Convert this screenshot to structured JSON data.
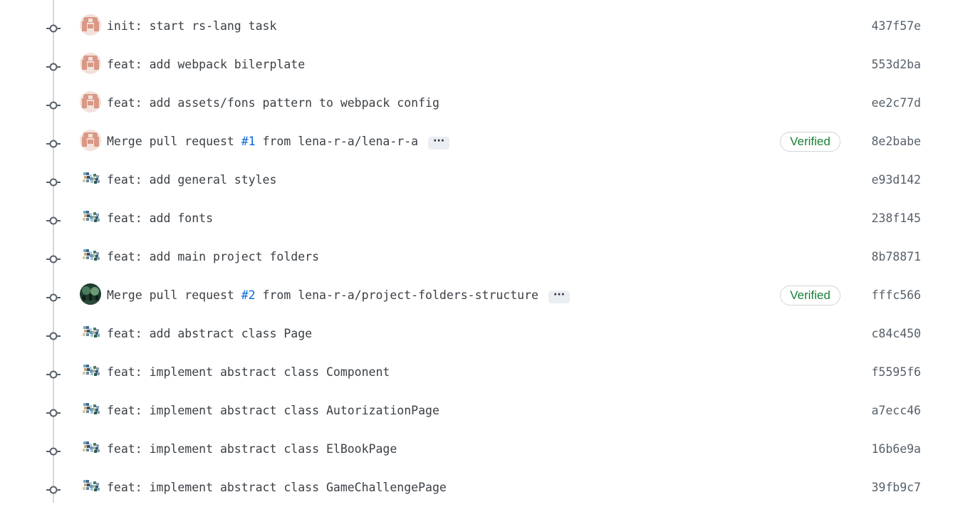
{
  "colors": {
    "timeline": "#d0d7de",
    "text": "#3b4046",
    "link": "#0969da",
    "verified": "#1a7f37",
    "sha": "#57606a"
  },
  "commits": [
    {
      "author_avatar": "identicon-avatar",
      "prefix": "init: start rs-lang task",
      "pr": "",
      "suffix": "",
      "has_ellipsis": false,
      "verified": "",
      "sha": "437f57e"
    },
    {
      "author_avatar": "identicon-avatar",
      "prefix": "feat: add webpack bilerplate",
      "pr": "",
      "suffix": "",
      "has_ellipsis": false,
      "verified": "",
      "sha": "553d2ba"
    },
    {
      "author_avatar": "identicon-avatar",
      "prefix": "feat: add assets/fons pattern to webpack config",
      "pr": "",
      "suffix": "",
      "has_ellipsis": false,
      "verified": "",
      "sha": "ee2c77d"
    },
    {
      "author_avatar": "identicon-avatar",
      "prefix": "Merge pull request ",
      "pr": "#1",
      "suffix": " from lena-r-a/lena-r-a",
      "has_ellipsis": true,
      "verified": "Verified",
      "sha": "8e2babe"
    },
    {
      "author_avatar": "pixel-avatar",
      "prefix": "feat: add general styles",
      "pr": "",
      "suffix": "",
      "has_ellipsis": false,
      "verified": "",
      "sha": "e93d142"
    },
    {
      "author_avatar": "pixel-avatar",
      "prefix": "feat: add fonts",
      "pr": "",
      "suffix": "",
      "has_ellipsis": false,
      "verified": "",
      "sha": "238f145"
    },
    {
      "author_avatar": "pixel-avatar",
      "prefix": "feat: add main project folders",
      "pr": "",
      "suffix": "",
      "has_ellipsis": false,
      "verified": "",
      "sha": "8b78871"
    },
    {
      "author_avatar": "photo-avatar",
      "prefix": "Merge pull request ",
      "pr": "#2",
      "suffix": " from lena-r-a/project-folders-structure",
      "has_ellipsis": true,
      "verified": "Verified",
      "sha": "fffc566"
    },
    {
      "author_avatar": "pixel-avatar",
      "prefix": "feat: add abstract class Page",
      "pr": "",
      "suffix": "",
      "has_ellipsis": false,
      "verified": "",
      "sha": "c84c450"
    },
    {
      "author_avatar": "pixel-avatar",
      "prefix": "feat: implement abstract class Component",
      "pr": "",
      "suffix": "",
      "has_ellipsis": false,
      "verified": "",
      "sha": "f5595f6"
    },
    {
      "author_avatar": "pixel-avatar",
      "prefix": "feat: implement abstract class AutorizationPage",
      "pr": "",
      "suffix": "",
      "has_ellipsis": false,
      "verified": "",
      "sha": "a7ecc46"
    },
    {
      "author_avatar": "pixel-avatar",
      "prefix": "feat: implement abstract class ElBookPage",
      "pr": "",
      "suffix": "",
      "has_ellipsis": false,
      "verified": "",
      "sha": "16b6e9a"
    },
    {
      "author_avatar": "pixel-avatar",
      "prefix": "feat: implement abstract class GameChallengePage",
      "pr": "",
      "suffix": "",
      "has_ellipsis": false,
      "verified": "",
      "sha": "39fb9c7"
    }
  ],
  "ellipsis_label": "···"
}
